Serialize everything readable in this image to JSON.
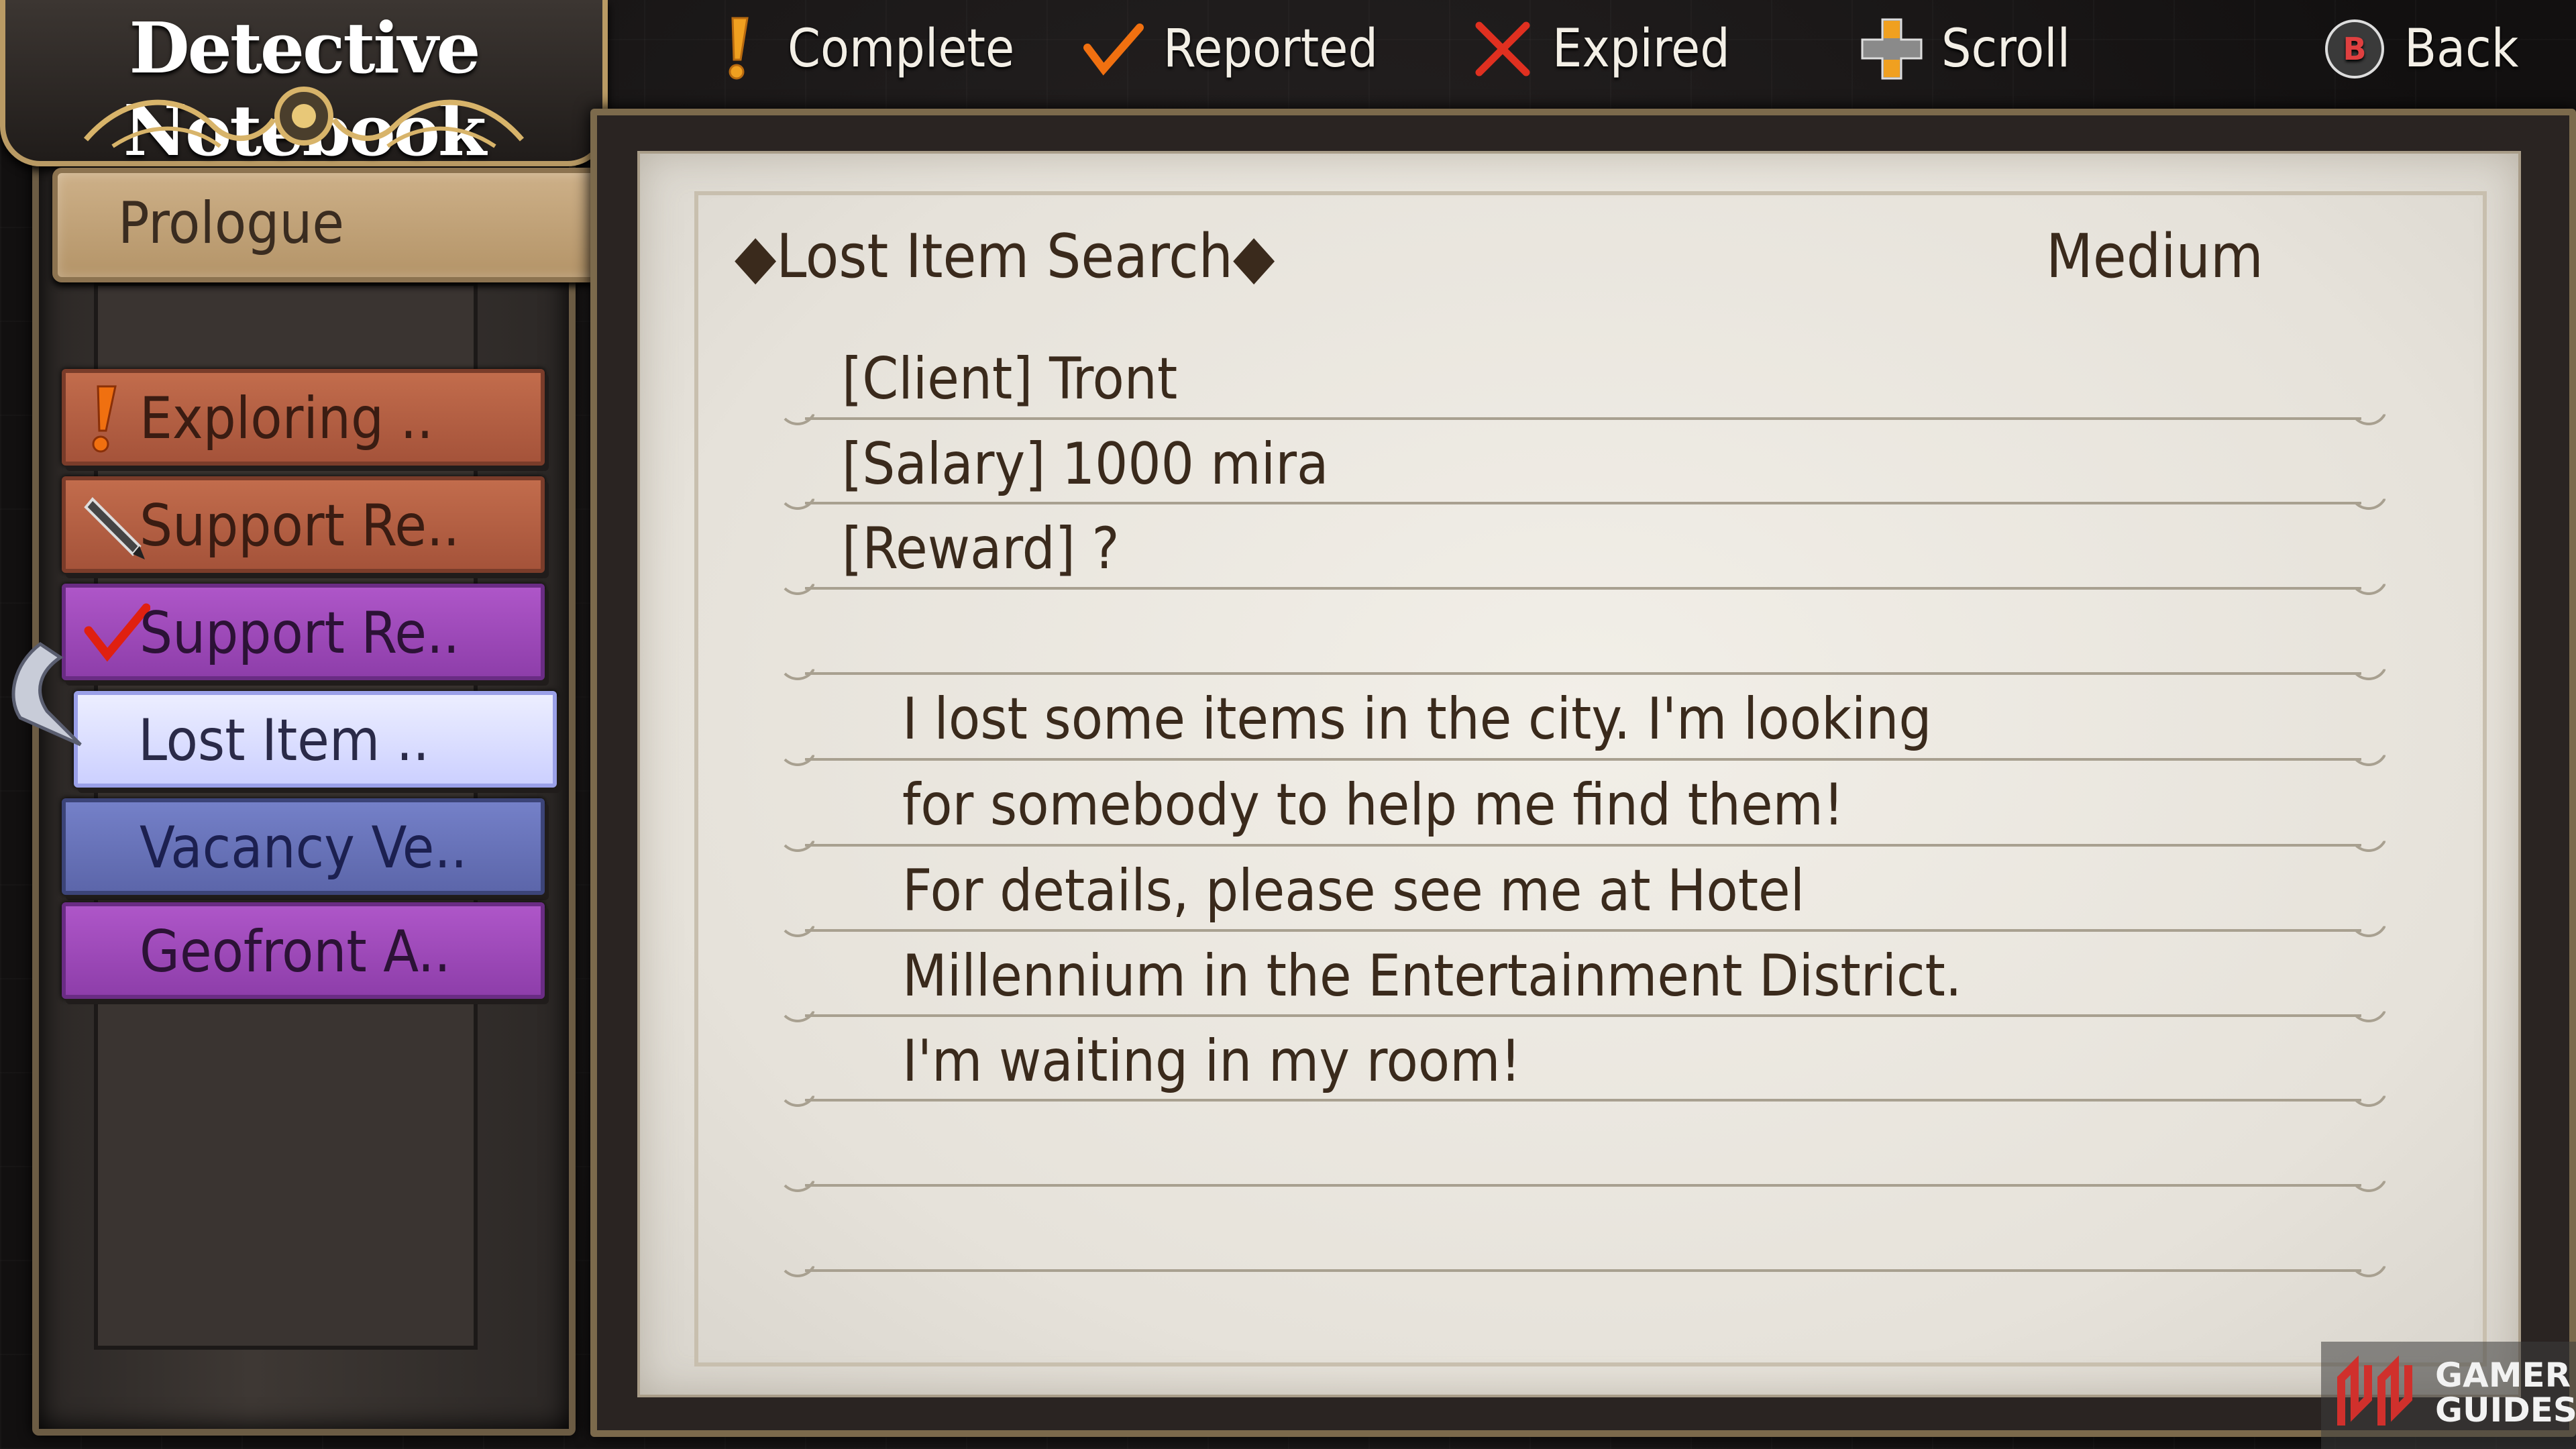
{
  "header": {
    "title": "Detective Notebook",
    "legend": [
      {
        "icon": "exclamation-icon",
        "label": "Complete"
      },
      {
        "icon": "checkmark-icon",
        "label": "Reported"
      },
      {
        "icon": "x-icon",
        "label": "Expired"
      },
      {
        "icon": "dpad-icon",
        "label": "Scroll"
      },
      {
        "icon": "b-button-icon",
        "button_letter": "B",
        "label": "Back"
      }
    ]
  },
  "sidebar": {
    "chapter": "Prologue",
    "quests": [
      {
        "label": "Exploring ..",
        "status_icon": "exclamation-icon",
        "color": "#c26c4c"
      },
      {
        "label": "Support Re..",
        "status_icon": "pen-icon",
        "color": "#c26c4c"
      },
      {
        "label": "Support Re..",
        "status_icon": "checkmark-icon",
        "color": "#ae56c8"
      },
      {
        "label": "Lost Item ..",
        "status_icon": "",
        "color": "#dfe2ff",
        "selected": true
      },
      {
        "label": "Vacancy Ve..",
        "status_icon": "",
        "color": "#7480c8"
      },
      {
        "label": "Geofront A..",
        "status_icon": "",
        "color": "#ae56c8"
      }
    ]
  },
  "detail": {
    "title": "◆Lost Item Search◆",
    "difficulty": "Medium",
    "client": "[Client]   Tront",
    "salary": "[Salary] 1000 mira",
    "reward": "[Reward] ?",
    "description": [
      "I lost some items in the city. I'm looking",
      "for somebody to help me find them!",
      "For details, please see me at Hotel",
      "Millennium in the Entertainment District.",
      "I'm waiting in my room!"
    ]
  },
  "watermark": {
    "line1": "GAMER",
    "line2": "GUIDES"
  }
}
